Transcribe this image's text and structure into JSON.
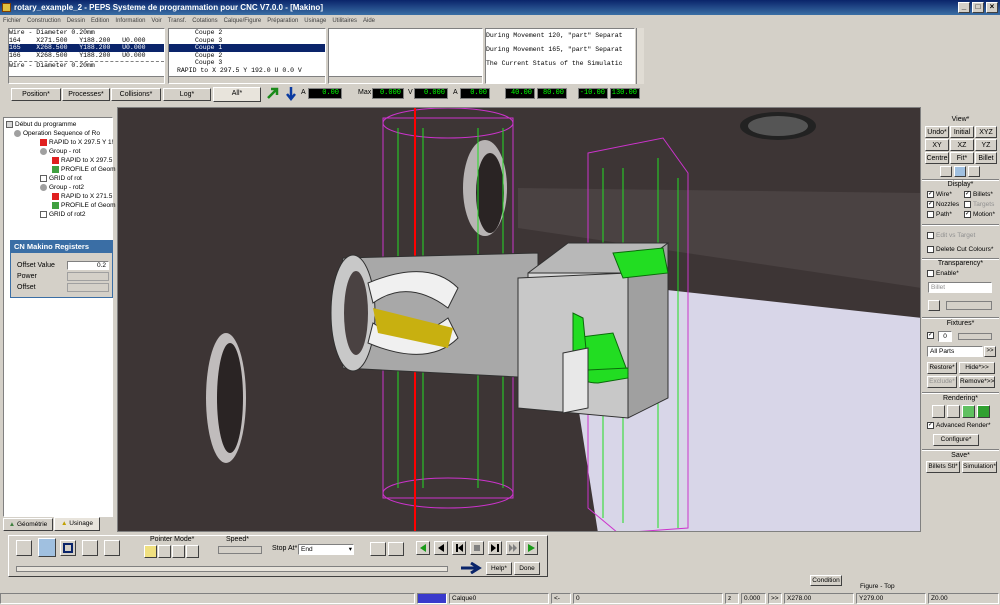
{
  "window": {
    "title": "rotary_example_2 - PEPS Systeme de programmation pour CNC V7.0.0 - [Makino]",
    "buttons": [
      "_",
      "□",
      "×"
    ]
  },
  "menu": [
    "Fichier",
    "Construction",
    "Dessin",
    "Edition",
    "Information",
    "Voir",
    "Transf.",
    "Cotations",
    "Calque/Figure",
    "Préparation",
    "Usinage",
    "Utilitaires",
    "Aide"
  ],
  "top_panels": {
    "position_lines": [
      "Wire - Diameter 0.20mm",
      "164    X271.500   Y188.200   U0.000",
      "165    X268.500   Y188.200   U0.000",
      "166    X268.500   Y188.200   U0.000",
      "Wire - Diameter 0.20mm"
    ],
    "process_lines": [
      "Coupe 2",
      "Coupe 3",
      "Coupe 1",
      "Coupe 2",
      "Coupe 3",
      "RAPID to X 297.5 Y 192.0 U 0.0 V"
    ],
    "log_lines": [
      "During Movement 120, \"part\" Separat",
      "During Movement 165, \"part\" Separat",
      "The Current Status of the Simulatic"
    ]
  },
  "tabs": [
    "Position*",
    "Processes*",
    "Collisions*",
    "Log*",
    "All*"
  ],
  "readouts": {
    "a_label": "A",
    "a_value": "0.00",
    "max_label": "Max",
    "max_value": "0.000",
    "v_label": "V",
    "v_value": "0.000",
    "a2_label": "A",
    "a2_value": "0.00",
    "r1": "40.00",
    "r2": "80.00",
    "r3": "-10.00",
    "r4": "130.00"
  },
  "tree": [
    "Début du programme",
    "Operation Sequence of Ro",
    "RAPID to X 297.5 Y 1!",
    "Group - rot",
    "RAPID to X 297.5",
    "PROFILE of Geom",
    "GRID of rot",
    "Group - rot2",
    "RAPID to X 271.5",
    "PROFILE of Geom",
    "GRID of rot2"
  ],
  "registers": {
    "title": "CN Makino Registers",
    "rows": [
      {
        "label": "Offset Value",
        "value": "0.2"
      },
      {
        "label": "Power",
        "value": ""
      },
      {
        "label": "Offset",
        "value": ""
      }
    ]
  },
  "left_tabs": [
    "Géométrie",
    "Usinage"
  ],
  "right_panel": {
    "view_title": "View*",
    "view_buttons_row1": [
      "Undo*",
      "Initial",
      "XYZ"
    ],
    "view_buttons_row2": [
      "XY",
      "XZ",
      "YZ"
    ],
    "view_buttons_row3": [
      "Centre",
      "Fit*",
      "Billet"
    ],
    "display_title": "Display*",
    "display_checks": [
      {
        "label": "Wire*",
        "checked": true
      },
      {
        "label": "Billets*",
        "checked": true
      },
      {
        "label": "Nozzles",
        "checked": true
      },
      {
        "label": "Targets",
        "checked": false
      },
      {
        "label": "Path*",
        "checked": false
      },
      {
        "label": "Motion*",
        "checked": true
      }
    ],
    "edit_target": "Edit vs Target",
    "delete_cut": "Delete Cut Colours*",
    "transparency_title": "Transparency*",
    "enable_label": "Enable*",
    "billet_select": "Billet",
    "fixtures_title": "Fixtures*",
    "fixtures_value": "0",
    "all_parts": "All Parts",
    "restore": "Restore*",
    "hide": "Hide*>>",
    "exclude": "Exclude*",
    "remove": "Remove*>>",
    "rendering_title": "Rendering*",
    "advanced_render": "Advanced Render*",
    "configure": "Configure*",
    "save_title": "Save*",
    "billets_stl": "Billets Stl*",
    "simulation": "Simulation*"
  },
  "bottom": {
    "pointer_mode": "Pointer Mode*",
    "speed": "Speed*",
    "stop_at_label": "Stop At*",
    "stop_at_value": "End",
    "help": "Help*",
    "done": "Done"
  },
  "statusbar": {
    "condition": "Condition",
    "figure": "Figure - Top",
    "calque": "Calque0",
    "z_label": "z",
    "z_value": "0.000",
    "x": "X278.00",
    "y": "Y279.00",
    "zz": "Z0.00",
    "zero": "0"
  },
  "colors": {
    "viewport_dark": "#3d3535",
    "viewport_light": "#d8d6e8",
    "part_green": "#22dd22",
    "wire_magenta": "#cc33cc",
    "red_axis": "#ff0000",
    "selection": "#0a246a"
  }
}
